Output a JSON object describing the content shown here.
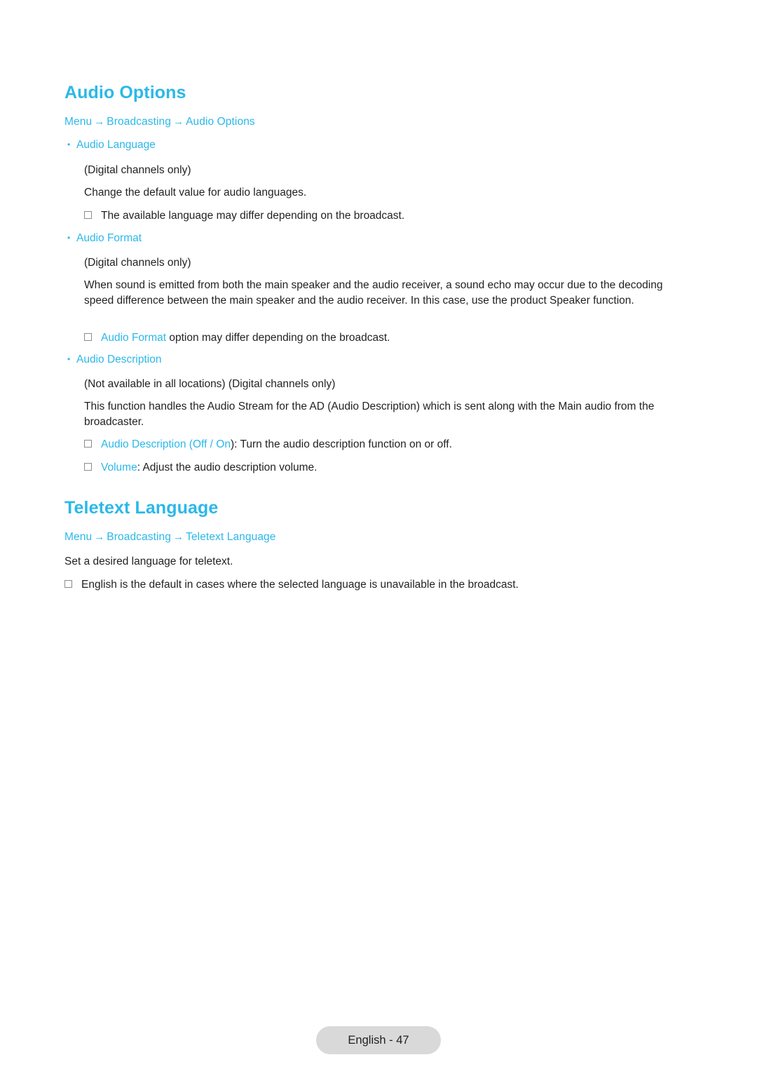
{
  "page": {
    "sections": [
      {
        "title": "Audio Options",
        "breadcrumb": [
          "Menu",
          "Broadcasting",
          "Audio Options"
        ]
      },
      {
        "title": "Teletext Language",
        "breadcrumb": [
          "Menu",
          "Broadcasting",
          "Teletext Language"
        ]
      }
    ],
    "arrow": "→",
    "bullet": "•",
    "audio_language": {
      "label": "Audio Language",
      "digital_only": "(Digital channels only)",
      "description": "Change the default value for audio languages.",
      "note": "The available language may differ depending on the broadcast."
    },
    "audio_format": {
      "label": "Audio Format",
      "digital_only": "(Digital channels only)",
      "description": "When sound is emitted from both the main speaker and the audio receiver, a sound echo may occur due to the decoding speed difference between the main speaker and the audio receiver. In this case, use the product Speaker function.",
      "note_link": "Audio Format",
      "note_rest": " option may differ depending on the broadcast."
    },
    "audio_description": {
      "label": "Audio Description",
      "availability": "(Not available in all locations) (Digital channels only)",
      "description": "This function handles the Audio Stream for the AD (Audio Description) which is sent along with the Main audio from the broadcaster.",
      "note1_link": "Audio Description",
      "note1_open": " (",
      "note1_off": "Off",
      "note1_sep": " / ",
      "note1_on": "On",
      "note1_rest": "): Turn the audio description function on or off.",
      "note2_link": "Volume",
      "note2_rest": ": Adjust the audio description volume."
    },
    "teletext": {
      "description": "Set a desired language for teletext.",
      "note": "English is the default in cases where the selected language is unavailable in the broadcast."
    },
    "footer": "English - 47",
    "colors": {
      "accent": "#2bb8e8",
      "text": "#231f20",
      "footer_bg": "#d9d9d9"
    }
  }
}
